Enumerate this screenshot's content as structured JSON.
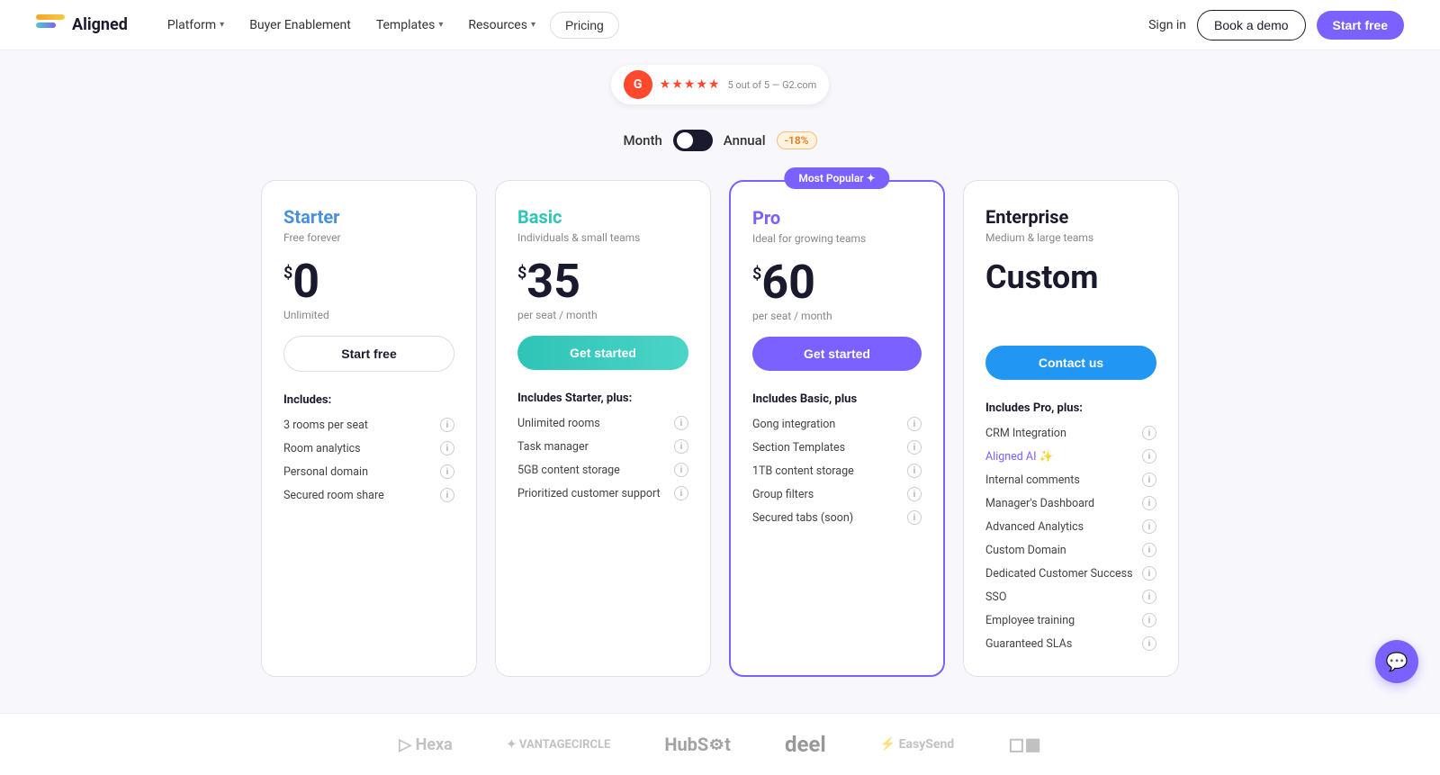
{
  "brand": {
    "name": "Aligned"
  },
  "nav": {
    "links": [
      {
        "label": "Platform",
        "hasDropdown": true
      },
      {
        "label": "Buyer Enablement",
        "hasDropdown": false
      },
      {
        "label": "Templates",
        "hasDropdown": true
      },
      {
        "label": "Resources",
        "hasDropdown": true
      }
    ],
    "pricing_label": "Pricing",
    "signin_label": "Sign in",
    "book_demo_label": "Book a demo",
    "start_free_label": "Start free"
  },
  "g2": {
    "letter": "G",
    "stars": "★★★★★",
    "text": "5 out of 5 — G2.com"
  },
  "billing": {
    "month_label": "Month",
    "annual_label": "Annual",
    "discount_label": "-18%"
  },
  "plans": [
    {
      "id": "starter",
      "name": "Starter",
      "subtitle": "Free forever",
      "price_dollar": "$",
      "price_amount": "0",
      "price_custom": null,
      "price_per": "Unlimited",
      "cta": "Start free",
      "includes_label": "Includes:",
      "features": [
        {
          "text": "3 rooms per seat",
          "highlight": false
        },
        {
          "text": "Room analytics",
          "highlight": false
        },
        {
          "text": "Personal domain",
          "highlight": false
        },
        {
          "text": "Secured room share",
          "highlight": false
        }
      ]
    },
    {
      "id": "basic",
      "name": "Basic",
      "subtitle": "Individuals & small teams",
      "price_dollar": "$",
      "price_amount": "35",
      "price_custom": null,
      "price_per": "per seat / month",
      "cta": "Get started",
      "includes_label": "Includes Starter, plus:",
      "features": [
        {
          "text": "Unlimited rooms",
          "highlight": false
        },
        {
          "text": "Task manager",
          "highlight": false
        },
        {
          "text": "5GB content storage",
          "highlight": false
        },
        {
          "text": "Prioritized customer support",
          "highlight": false
        }
      ]
    },
    {
      "id": "pro",
      "name": "Pro",
      "subtitle": "Ideal for growing teams",
      "price_dollar": "$",
      "price_amount": "60",
      "price_custom": null,
      "price_per": "per seat / month",
      "cta": "Get started",
      "badge": "Most Popular ✦",
      "includes_label": "Includes Basic, plus",
      "features": [
        {
          "text": "Gong integration",
          "highlight": false
        },
        {
          "text": "Section Templates",
          "highlight": false
        },
        {
          "text": "1TB content storage",
          "highlight": false
        },
        {
          "text": "Group filters",
          "highlight": false
        },
        {
          "text": "Secured tabs (soon)",
          "highlight": false
        }
      ]
    },
    {
      "id": "enterprise",
      "name": "Enterprise",
      "subtitle": "Medium & large teams",
      "price_dollar": null,
      "price_amount": null,
      "price_custom": "Custom",
      "price_per": null,
      "cta": "Contact us",
      "includes_label": "Includes Pro, plus:",
      "features": [
        {
          "text": "CRM Integration",
          "highlight": false
        },
        {
          "text": "Aligned AI ✨",
          "highlight": true
        },
        {
          "text": "Internal comments",
          "highlight": false
        },
        {
          "text": "Manager's Dashboard",
          "highlight": false
        },
        {
          "text": "Advanced Analytics",
          "highlight": false
        },
        {
          "text": "Custom Domain",
          "highlight": false
        },
        {
          "text": "Dedicated Customer Success",
          "highlight": false
        },
        {
          "text": "SSO",
          "highlight": false
        },
        {
          "text": "Employee training",
          "highlight": false
        },
        {
          "text": "Guaranteed SLAs",
          "highlight": false
        }
      ]
    }
  ],
  "logos": [
    {
      "text": "Hexa"
    },
    {
      "text": "VANTAGE CIRCLE"
    },
    {
      "text": "HubSpot"
    },
    {
      "text": "deel"
    },
    {
      "text": "EasySend"
    },
    {
      "text": "◻"
    }
  ]
}
